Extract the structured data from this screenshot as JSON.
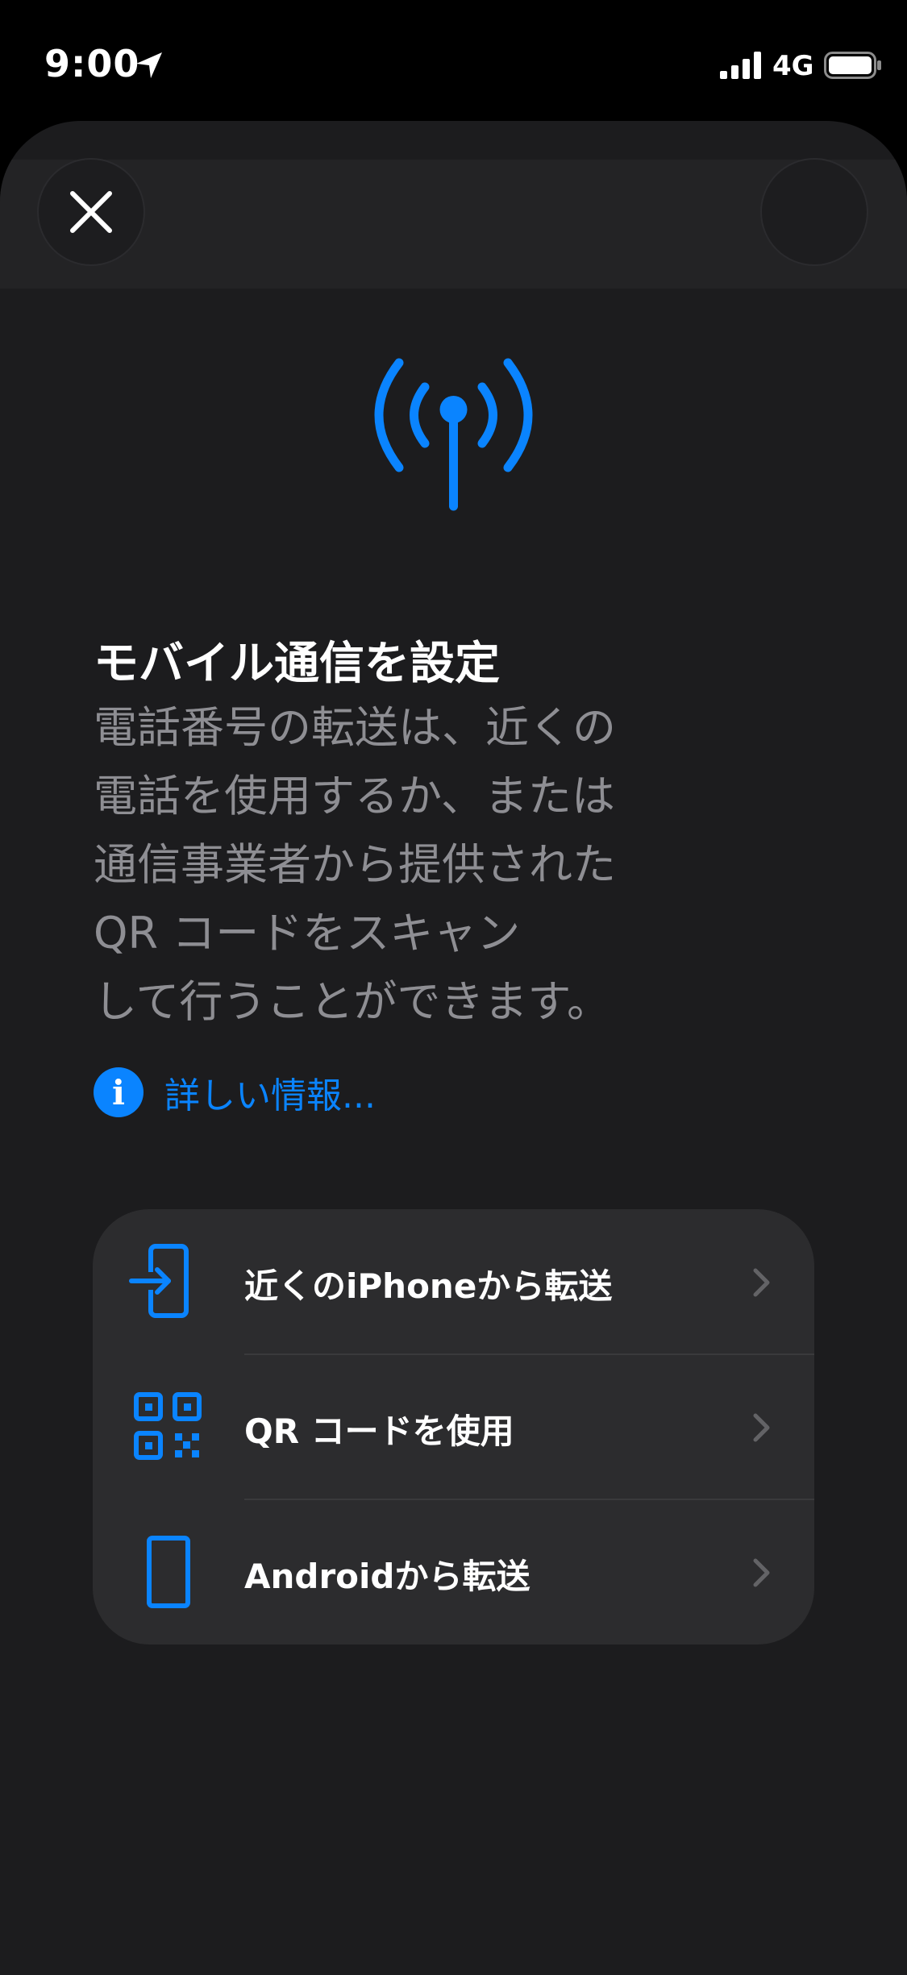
{
  "status_bar": {
    "time": "9:00",
    "network": "4G"
  },
  "sheet": {
    "title": "モバイル通信を設定",
    "description_lines": [
      "電話番号の転送は、近くの",
      "電話を使用するか、または",
      "通信事業者から提供された",
      "QR コードをスキャン",
      "して行うことができます。"
    ],
    "learn_more": "詳しい情報..."
  },
  "options": [
    {
      "label": "近くのiPhoneから転送",
      "icon": "phone-transfer-icon"
    },
    {
      "label": "QR コードを使用",
      "icon": "qr-code-icon"
    },
    {
      "label": "Androidから転送",
      "icon": "android-phone-icon"
    }
  ],
  "colors": {
    "accent": "#0a84ff",
    "background": "#000000",
    "sheet": "#1c1c1e",
    "card": "#2c2c2e",
    "secondary_text": "#8e8e93"
  }
}
